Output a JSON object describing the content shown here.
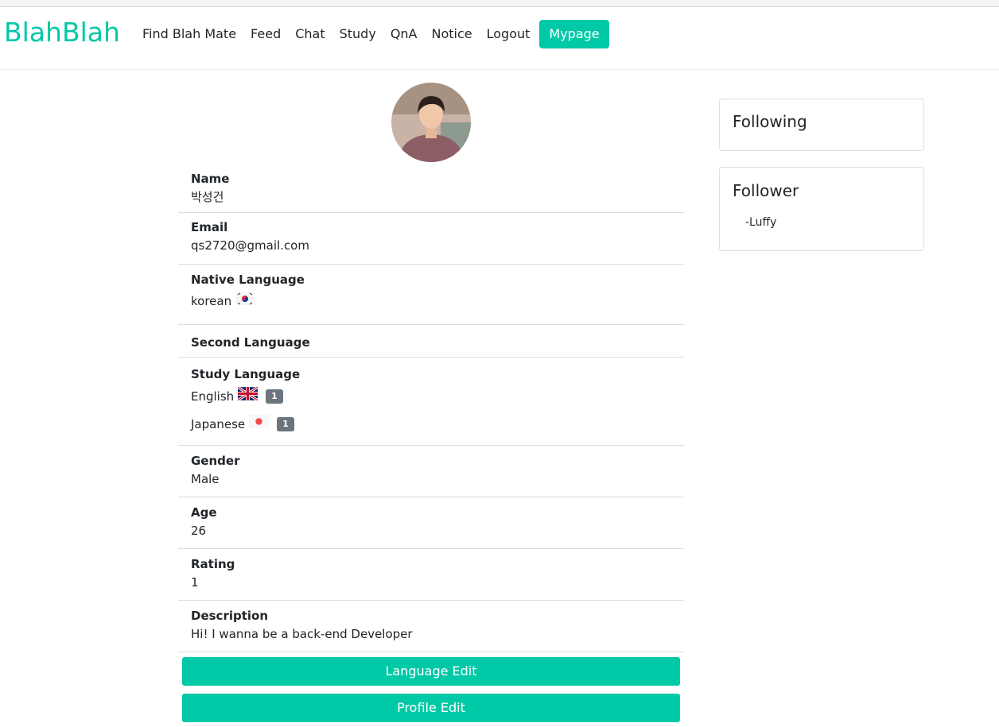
{
  "nav": {
    "brand": "BlahBlah",
    "links": [
      "Find Blah Mate",
      "Feed",
      "Chat",
      "Study",
      "QnA",
      "Notice",
      "Logout"
    ],
    "active": "Mypage"
  },
  "profile": {
    "name_label": "Name",
    "name": "박성건",
    "email_label": "Email",
    "email": "qs2720@gmail.com",
    "native_label": "Native Language",
    "native": "korean",
    "second_label": "Second Language",
    "study_label": "Study Language",
    "study": [
      {
        "lang": "English",
        "level": "1",
        "flag": "uk-flag-icon"
      },
      {
        "lang": "Japanese",
        "level": "1",
        "flag": "japan-flag-icon"
      }
    ],
    "gender_label": "Gender",
    "gender": "Male",
    "age_label": "Age",
    "age": "26",
    "rating_label": "Rating",
    "rating": "1",
    "description_label": "Description",
    "description": "Hi! I wanna be a back-end Developer"
  },
  "buttons": {
    "language_edit": "Language Edit",
    "profile_edit": "Profile Edit"
  },
  "following": {
    "title": "Following",
    "items": []
  },
  "follower": {
    "title": "Follower",
    "items": [
      "-Luffy"
    ]
  },
  "colors": {
    "accent": "#00c9a7",
    "badge": "#6c757d"
  }
}
